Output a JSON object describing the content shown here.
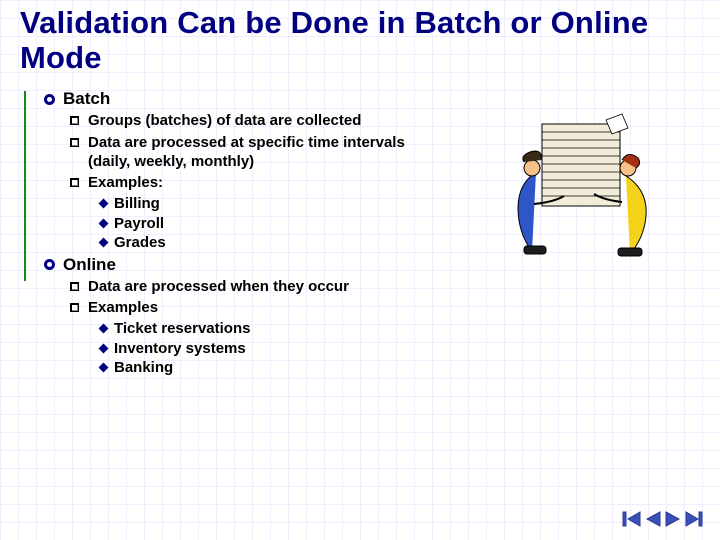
{
  "title": "Validation Can be Done in Batch or Online Mode",
  "sections": [
    {
      "heading": "Batch",
      "items": [
        {
          "text": "Groups (batches) of data are collected"
        },
        {
          "text": "Data are processed at specific time intervals (daily, weekly, monthly)"
        },
        {
          "text": "Examples:",
          "sub": [
            "Billing",
            "Payroll",
            "Grades"
          ]
        }
      ]
    },
    {
      "heading": "Online",
      "items": [
        {
          "text": "Data are processed when they occur"
        },
        {
          "text": "Examples",
          "sub": [
            "Ticket reservations",
            "Inventory systems",
            "Banking"
          ]
        }
      ]
    }
  ],
  "illustration": {
    "alt": "Two stylized figures carrying a tall stack of papers"
  },
  "nav": {
    "first": "first-slide",
    "prev": "previous-slide",
    "next": "next-slide",
    "last": "last-slide"
  },
  "colors": {
    "titleColor": "#000080",
    "accent": "#168a16"
  }
}
